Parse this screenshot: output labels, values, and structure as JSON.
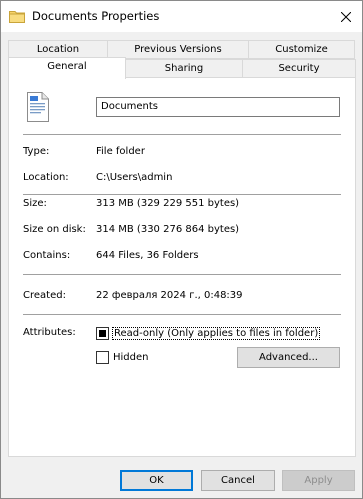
{
  "window": {
    "title": "Documents Properties"
  },
  "tabs": {
    "row1": [
      "Location",
      "Previous Versions",
      "Customize"
    ],
    "row2": [
      "General",
      "Sharing",
      "Security"
    ]
  },
  "general": {
    "name_value": "Documents",
    "fields": [
      {
        "label": "Type:",
        "value": "File folder"
      },
      {
        "label": "Location:",
        "value": "C:\\Users\\admin"
      },
      {
        "label": "Size:",
        "value": "313 MB (329 229 551 bytes)"
      },
      {
        "label": "Size on disk:",
        "value": "314 MB (330 276 864 bytes)"
      },
      {
        "label": "Contains:",
        "value": "644 Files, 36 Folders"
      },
      {
        "label": "Created:",
        "value": "22 февраля 2024 г., 0:48:39"
      }
    ],
    "attributes_label": "Attributes:",
    "readonly_label": "Read-only (Only applies to files in folder)",
    "readonly_state": "indeterminate",
    "hidden_label": "Hidden",
    "hidden_checked": false,
    "advanced_label": "Advanced..."
  },
  "buttons": {
    "ok": "OK",
    "cancel": "Cancel",
    "apply": "Apply"
  },
  "colors": {
    "accent": "#0078d7",
    "panel": "#ffffff",
    "chrome": "#f0f0f0"
  }
}
